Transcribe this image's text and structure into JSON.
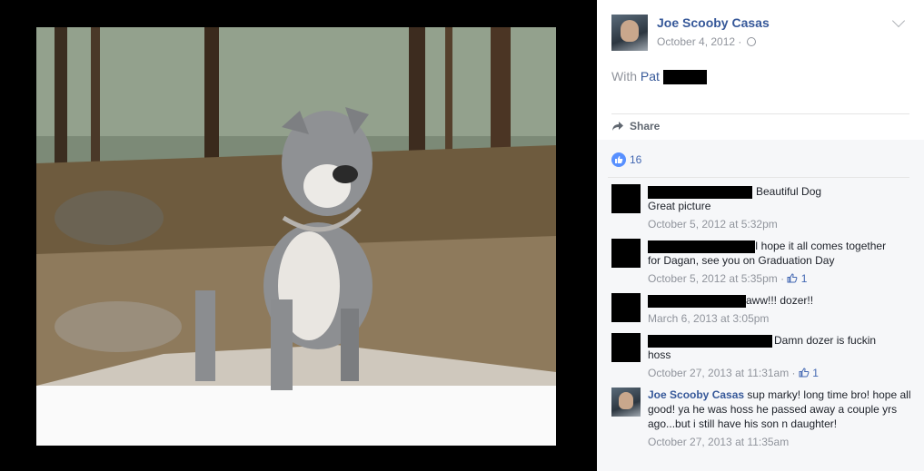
{
  "post": {
    "author": "Joe Scooby Casas",
    "date": "October 4, 2012 ·",
    "with_prefix": "With",
    "tagged": "Pat",
    "share_label": "Share",
    "like_count": "16"
  },
  "comments": [
    {
      "text1": "Beautiful Dog",
      "text2": "Great picture",
      "meta": "October 5, 2012 at 5:32pm"
    },
    {
      "text1": "I hope it all comes together",
      "text2": "for Dagan, see you on Graduation Day",
      "meta": "October 5, 2012 at 5:35pm ·",
      "likes": "1"
    },
    {
      "text1": "aww!!! dozer!!",
      "meta": "March 6, 2013 at 3:05pm"
    },
    {
      "text1": "Damn dozer is fuckin",
      "text2": "hoss",
      "meta": "October 27, 2013 at 11:31am ·",
      "likes": "1"
    },
    {
      "author": "Joe Scooby Casas",
      "text1": "sup marky! long time bro! hope all good! ya he was hoss he passed away a couple yrs ago...but i still have his son n daughter!",
      "meta": "October 27, 2013 at 11:35am"
    }
  ],
  "icons": {
    "like": "thumbs-up-icon",
    "share": "share-arrow-icon",
    "privacy": "globe-icon",
    "menu": "chevron-down-icon"
  },
  "colors": {
    "link": "#365899",
    "muted": "#90949c",
    "like_blue": "#5890ff"
  }
}
